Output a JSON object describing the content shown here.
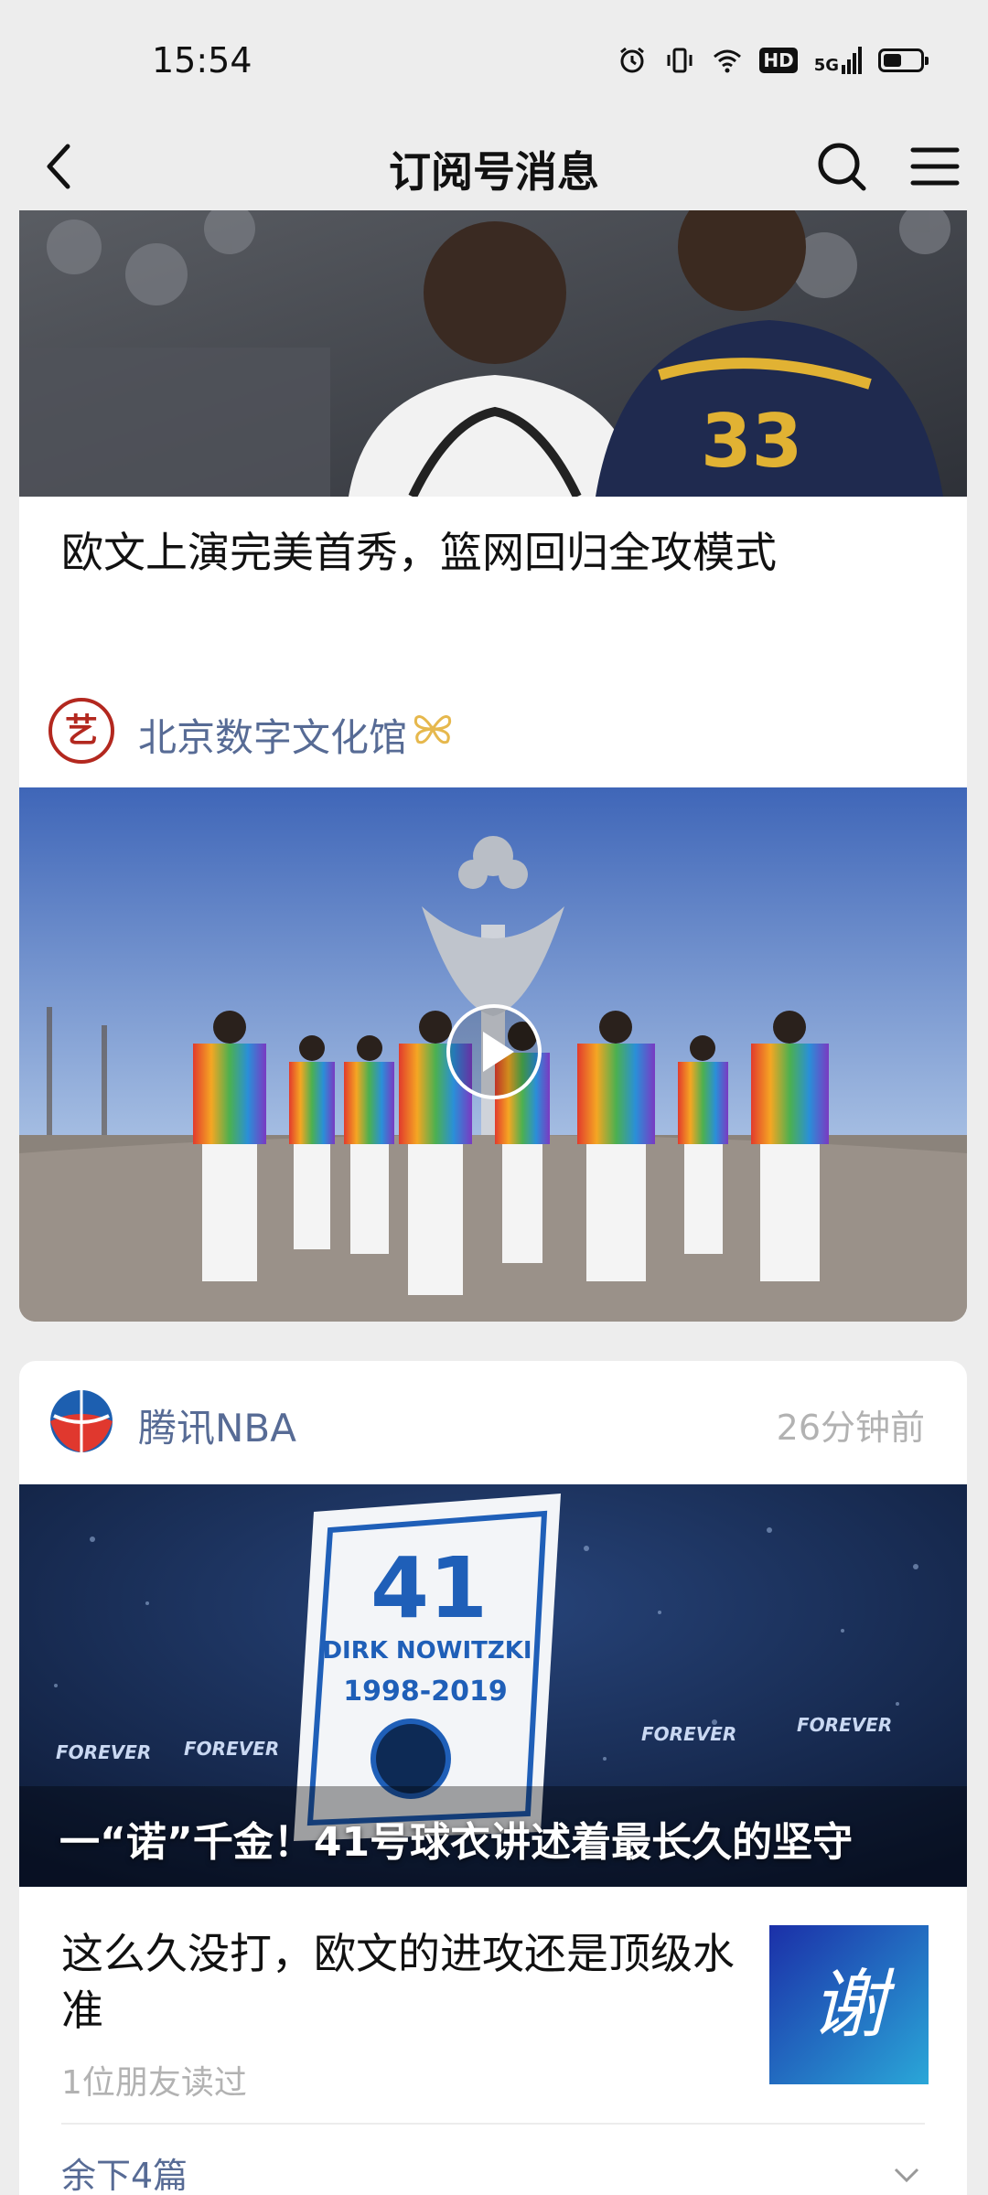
{
  "status_bar": {
    "time": "15:54",
    "hd": "HD",
    "network": "5G",
    "icons": [
      "alarm-icon",
      "vibrate-icon",
      "wifi-icon",
      "hd-icon",
      "signal-5g-icon",
      "battery-icon"
    ],
    "battery_level": 0.5
  },
  "nav": {
    "title": "订阅号消息",
    "icons": [
      "back-icon",
      "search-icon",
      "menu-icon"
    ]
  },
  "card1": {
    "title": "欧文上演完美首秀，篮网回归全攻模式"
  },
  "card2": {
    "source_name": "北京数字文化馆",
    "badge_icon": "verified-butterfly-icon",
    "logo_icon": "beijing-culture-logo",
    "logo_text": "艺",
    "media": "video"
  },
  "card3": {
    "source_name": "腾讯NBA",
    "time": "26分钟前",
    "image_caption": "一“诺”千金！41号球衣讲述着最长久的坚守",
    "jersey": {
      "number": "41",
      "name": "DIRK NOWITZKI",
      "years": "1998-2019"
    },
    "banner_word": "FOREVER",
    "article_title": "这么久没打，欧文的进攻还是顶级水准",
    "article_meta": "1位朋友读过",
    "thumb_char": "谢",
    "expand_label": "余下4篇"
  },
  "colors": {
    "background": "#ededed",
    "link_blue": "#576b95",
    "meta_gray": "#b2b2b2"
  }
}
